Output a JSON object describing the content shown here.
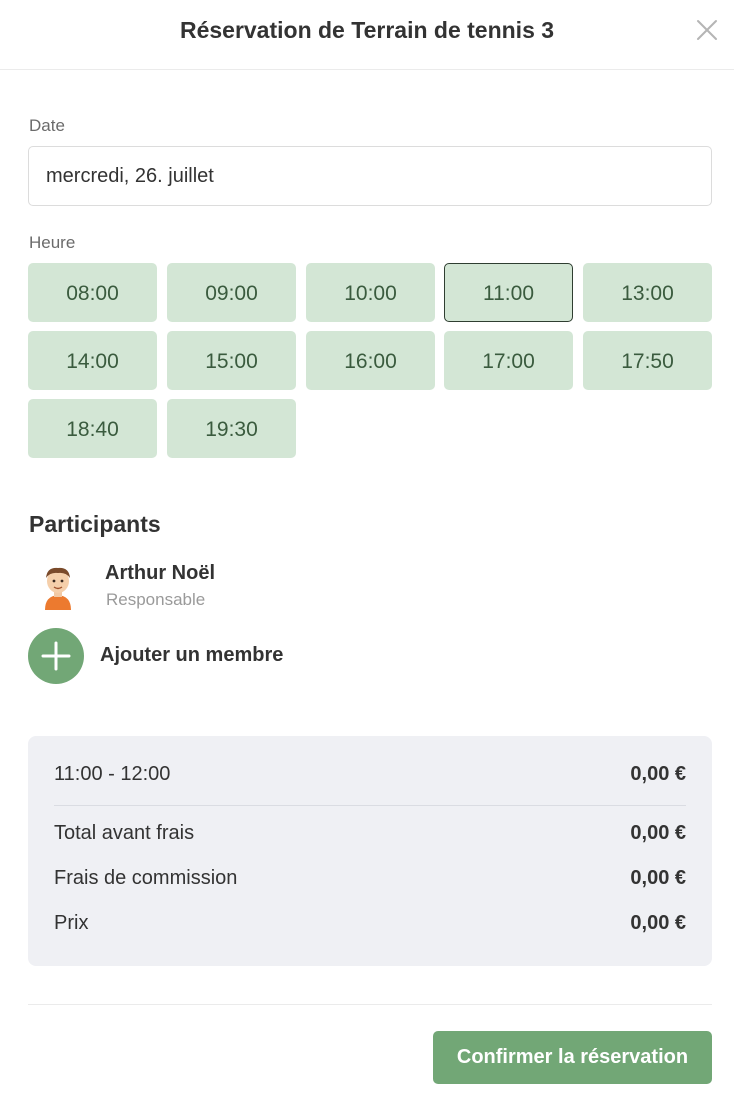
{
  "header": {
    "title": "Réservation de Terrain de tennis 3",
    "close_icon": "close-icon"
  },
  "date": {
    "label": "Date",
    "value": "mercredi, 26. juillet"
  },
  "time": {
    "label": "Heure",
    "selected": "11:00",
    "slots": [
      "08:00",
      "09:00",
      "10:00",
      "11:00",
      "13:00",
      "14:00",
      "15:00",
      "16:00",
      "17:00",
      "17:50",
      "18:40",
      "19:30"
    ]
  },
  "participants": {
    "title": "Participants",
    "list": [
      {
        "name": "Arthur Noël",
        "role": "Responsable",
        "avatar_icon": "avatar-icon"
      }
    ],
    "add_label": "Ajouter un membre",
    "add_icon": "plus-icon"
  },
  "summary": {
    "slot_range": "11:00 - 12:00",
    "slot_price": "0,00 €",
    "rows": [
      {
        "label": "Total avant frais",
        "value": "0,00 €"
      },
      {
        "label": "Frais de commission",
        "value": "0,00 €"
      },
      {
        "label": "Prix",
        "value": "0,00 €"
      }
    ]
  },
  "footer": {
    "confirm_label": "Confirmer la réservation"
  },
  "colors": {
    "accent": "#72a776",
    "slot_bg": "#d3e6d5",
    "slot_text": "#3a5b3e",
    "summary_bg": "#eff0f4"
  }
}
